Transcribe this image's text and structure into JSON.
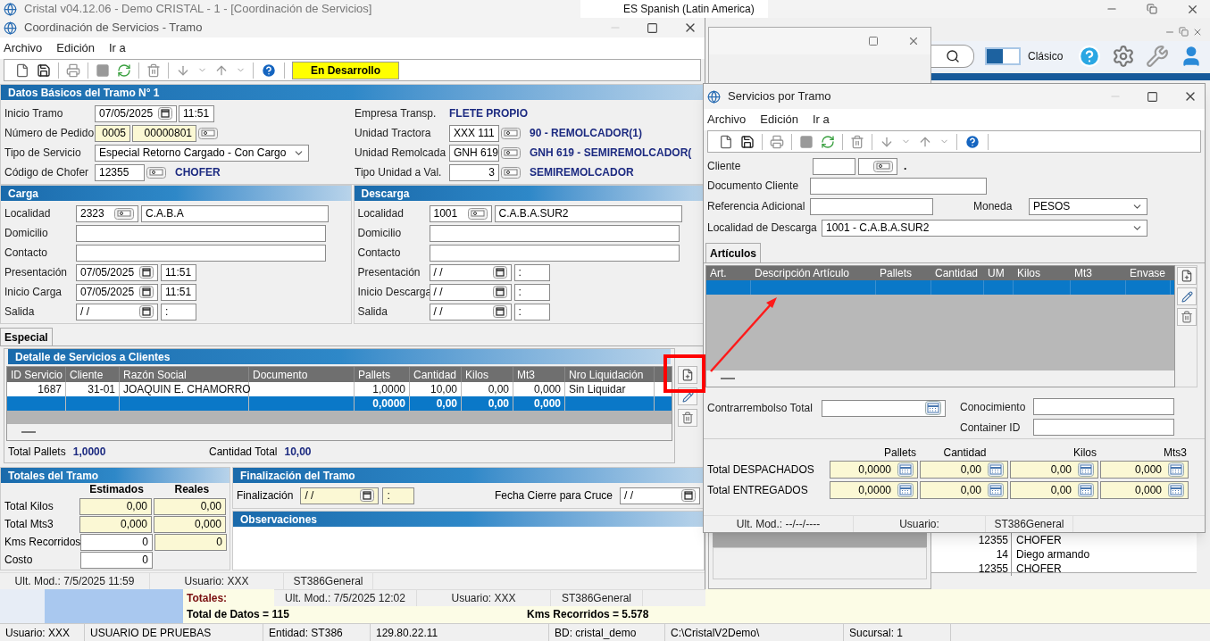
{
  "app": {
    "title": "Cristal v04.12.06 - Demo CRISTAL - 1 - [Coordinación de Servicios]",
    "language": "ES Spanish (Latin America)",
    "theme_label": "Clásico",
    "theme_switch": {
      "on": true
    },
    "background_list": [
      {
        "code": "12355",
        "name": "CHOFER"
      },
      {
        "code": "14",
        "name": "Diego armando"
      },
      {
        "code": "12355",
        "name": "CHOFER"
      }
    ],
    "totals": {
      "label": "Totales:",
      "datos": "Total de Datos = 115",
      "kms": "Kms Recorridos = 5.578"
    },
    "back_status": [
      "Ult. Mod.: 7/5/2025 12:02",
      "Usuario: XXX",
      "ST386General"
    ],
    "status_bar": [
      "Usuario: XXX",
      "USUARIO DE PRUEBAS",
      "Entidad: ST386",
      "129.80.22.11",
      "BD: cristal_demo",
      "C:\\CristalV2Demo\\",
      "Sucursal: 1"
    ]
  },
  "tramo": {
    "title": "Coordinación de Servicios - Tramo",
    "menu": [
      "Archivo",
      "Edición",
      "Ir a"
    ],
    "badge": "En Desarrollo",
    "basic": {
      "heading": "Datos Básicos del Tramo N° 1",
      "left": [
        {
          "label": "Inicio Tramo",
          "kind": "datetime",
          "date": "07/05/2025",
          "time": "11:51"
        },
        {
          "label": "Número de Pedido",
          "kind": "pedido",
          "values": [
            {
              "value": "0005",
              "readonly": true
            },
            {
              "value": "00000801",
              "readonly": true
            }
          ]
        },
        {
          "label": "Tipo de Servicio",
          "kind": "select",
          "value": "Especial Retorno Cargado - Con Cargo"
        },
        {
          "label": "Código de Chofer",
          "kind": "lookup",
          "value": "12355",
          "description": "CHOFER"
        }
      ],
      "right": [
        {
          "label": "Empresa Transp.",
          "kind": "info",
          "description": "FLETE PROPIO"
        },
        {
          "label": "Unidad Tractora",
          "kind": "lookup",
          "value": "XXX 111",
          "description": "90 - REMOLCADOR(1)"
        },
        {
          "label": "Unidad Remolcada",
          "kind": "lookup",
          "value": "GNH 619",
          "description": "GNH 619 - SEMIREMOLCADOR("
        },
        {
          "label": "Tipo Unidad a Val.",
          "kind": "lookup_num",
          "value": "3",
          "description": "SEMIREMOLCADOR"
        }
      ]
    },
    "stops": [
      {
        "heading": "Carga",
        "rows": [
          {
            "label": "Localidad",
            "kind": "locality",
            "code": "2323",
            "name": "C.A.B.A"
          },
          {
            "label": "Domicilio",
            "kind": "text"
          },
          {
            "label": "Contacto",
            "kind": "text"
          },
          {
            "label": "Presentación",
            "kind": "datetime",
            "date": "07/05/2025",
            "time": "11:51"
          },
          {
            "label": "Inicio Carga",
            "kind": "datetime",
            "date": "07/05/2025",
            "time": "11:51"
          },
          {
            "label": "Salida",
            "kind": "datetime",
            "date": "/ /",
            "time": ":"
          }
        ]
      },
      {
        "heading": "Descarga",
        "rows": [
          {
            "label": "Localidad",
            "kind": "locality",
            "code": "1001",
            "name": "C.A.B.A.SUR2"
          },
          {
            "label": "Domicilio",
            "kind": "text"
          },
          {
            "label": "Contacto",
            "kind": "text"
          },
          {
            "label": "Presentación",
            "kind": "datetime",
            "date": "/ /",
            "time": ":"
          },
          {
            "label": "Inicio Descarga",
            "kind": "datetime",
            "date": "/ /",
            "time": ":"
          },
          {
            "label": "Salida",
            "kind": "datetime",
            "date": "/ /",
            "time": ":"
          }
        ]
      }
    ],
    "tabs": [
      {
        "label": "Especial",
        "selected": true
      }
    ],
    "detail": {
      "heading": "Detalle de Servicios a Clientes",
      "columns": [
        "ID Servicio",
        "Cliente",
        "Razón Social",
        "Documento",
        "Pallets",
        "Cantidad",
        "Kilos",
        "Mt3",
        "Nro Liquidación"
      ],
      "rows": [
        {
          "selected": false,
          "cells": [
            "1687",
            "31-01",
            "JOAQUIN E. CHAMORRO",
            null,
            "1,0000",
            "10,00",
            "0,00",
            "0,000",
            "Sin Liquidar"
          ]
        },
        {
          "selected": true,
          "cells": [
            null,
            null,
            null,
            null,
            "0,0000",
            "0,00",
            "0,00",
            "0,000",
            null
          ]
        }
      ],
      "totals": [
        {
          "label": "Total Pallets",
          "value": "1,0000"
        },
        {
          "label": "Cantidad Total",
          "value": "10,00"
        }
      ]
    },
    "totales": {
      "heading": "Totales del Tramo",
      "columns": [
        "Estimados",
        "Reales"
      ],
      "rows": [
        {
          "label": "Total Kilos",
          "values": [
            {
              "value": "0,00",
              "readonly": true
            },
            {
              "value": "0,00",
              "readonly": true
            }
          ]
        },
        {
          "label": "Total Mts3",
          "values": [
            {
              "value": "0,000",
              "readonly": true
            },
            {
              "value": "0,000",
              "readonly": true
            }
          ]
        },
        {
          "label": "Kms Recorridos",
          "values": [
            {
              "value": "0",
              "readonly": false
            },
            {
              "value": "0",
              "readonly": true
            }
          ]
        },
        {
          "label": "Costo",
          "values": [
            {
              "value": "0",
              "readonly": false
            }
          ]
        }
      ]
    },
    "finalizacion": {
      "heading": "Finalización del Tramo",
      "label": "Finalización",
      "date": "/ /",
      "time": ":",
      "cierre_label": "Fecha Cierre para Cruce",
      "cierre_date": "/ /"
    },
    "observaciones": {
      "heading": "Observaciones"
    },
    "status": [
      "Ult. Mod.: 7/5/2025 11:59",
      "Usuario: XXX",
      "ST386General"
    ]
  },
  "servicios": {
    "title": "Servicios por Tramo",
    "menu": [
      "Archivo",
      "Edición",
      "Ir a"
    ],
    "cliente": {
      "label": "Cliente",
      "suffix": "."
    },
    "documento": {
      "label": "Documento Cliente"
    },
    "referencia": {
      "label": "Referencia Adicional"
    },
    "moneda": {
      "label": "Moneda",
      "value": "PESOS"
    },
    "localidad": {
      "label": "Localidad de Descarga",
      "value": "1001 - C.A.B.A.SUR2"
    },
    "tabs": [
      {
        "label": "Artículos",
        "selected": true
      }
    ],
    "grid": {
      "columns": [
        "Art.",
        "Descripción Artículo",
        "Pallets",
        "Cantidad",
        "UM",
        "Kilos",
        "Mt3",
        "Envase"
      ],
      "rows": [
        {
          "selected": true
        }
      ]
    },
    "contrarrembolso": {
      "label": "Contrarrembolso Total"
    },
    "conocimiento": {
      "label": "Conocimiento"
    },
    "container": {
      "label": "Container ID"
    },
    "totals": {
      "columns": [
        "Pallets",
        "Cantidad",
        "Kilos",
        "Mts3"
      ],
      "rows": [
        {
          "label": "Total DESPACHADOS",
          "readonly": true,
          "values": [
            "0,0000",
            "0,00",
            "0,00",
            "0,000"
          ]
        },
        {
          "label": "Total ENTREGADOS",
          "readonly": true,
          "values": [
            "0,0000",
            "0,00",
            "0,00",
            "0,000"
          ]
        }
      ]
    },
    "status": [
      "Ult. Mod.: --/--/----",
      "Usuario:",
      "ST386General"
    ]
  }
}
